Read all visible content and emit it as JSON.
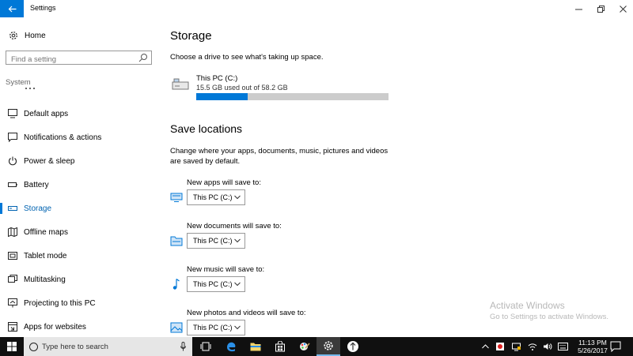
{
  "window": {
    "title": "Settings",
    "back_icon": "back-arrow-icon",
    "controls": [
      "minimize-icon",
      "maximize-icon",
      "close-icon"
    ]
  },
  "sidebar": {
    "home_label": "Home",
    "search_placeholder": "Find a setting",
    "section_label": "System",
    "items": [
      {
        "label": "Default apps",
        "icon": "default-apps-icon"
      },
      {
        "label": "Notifications & actions",
        "icon": "notifications-icon"
      },
      {
        "label": "Power & sleep",
        "icon": "power-icon"
      },
      {
        "label": "Battery",
        "icon": "battery-icon"
      },
      {
        "label": "Storage",
        "icon": "storage-icon",
        "active": true
      },
      {
        "label": "Offline maps",
        "icon": "map-icon"
      },
      {
        "label": "Tablet mode",
        "icon": "tablet-icon"
      },
      {
        "label": "Multitasking",
        "icon": "multitasking-icon"
      },
      {
        "label": "Projecting to this PC",
        "icon": "projecting-icon"
      },
      {
        "label": "Apps for websites",
        "icon": "apps-websites-icon"
      }
    ]
  },
  "main": {
    "title": "Storage",
    "subtitle": "Choose a drive to see what's taking up space.",
    "drive": {
      "name": "This PC (C:)",
      "usage_text": "15.5 GB used out of 58.2 GB",
      "used_fraction": 0.266
    },
    "save_title": "Save locations",
    "save_description": "Change where your apps, documents, music, pictures and videos are saved by default.",
    "save_rows": [
      {
        "label": "New apps will save to:",
        "value": "This PC (C:)",
        "icon": "monitor-icon"
      },
      {
        "label": "New documents will save to:",
        "value": "This PC (C:)",
        "icon": "documents-folder-icon"
      },
      {
        "label": "New music will save to:",
        "value": "This PC (C:)",
        "icon": "music-note-icon"
      },
      {
        "label": "New photos and videos will save to:",
        "value": "This PC (C:)",
        "icon": "photo-icon"
      }
    ]
  },
  "watermark": {
    "line1": "Activate Windows",
    "line2": "Go to Settings to activate Windows."
  },
  "taskbar": {
    "search_placeholder": "Type here to search",
    "time": "11:13 PM",
    "date": "5/26/2017",
    "accent_color": "#0078d7"
  }
}
